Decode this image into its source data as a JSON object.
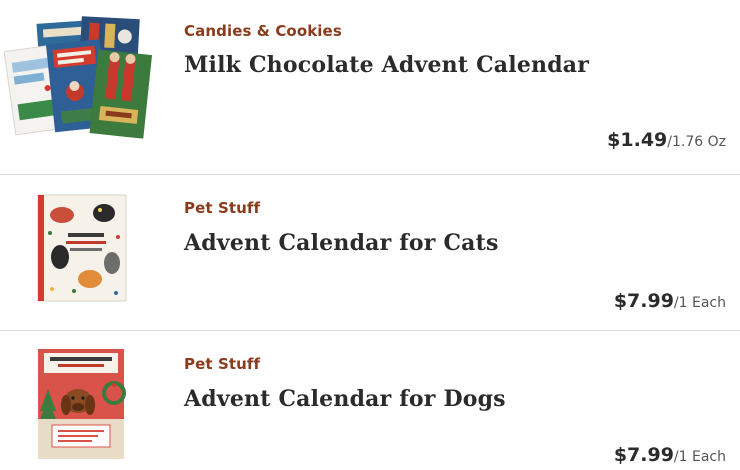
{
  "products": [
    {
      "category": "Candies & Cookies",
      "name": "Milk Chocolate Advent Calendar",
      "price": "$1.49",
      "unit": "/1.76 Oz",
      "image": "advent-calendars-assortment-image"
    },
    {
      "category": "Pet Stuff",
      "name": "Advent Calendar for Cats",
      "price": "$7.99",
      "unit": "/1 Each",
      "image": "cat-advent-calendar-image"
    },
    {
      "category": "Pet Stuff",
      "name": "Advent Calendar for Dogs",
      "price": "$7.99",
      "unit": "/1 Each",
      "image": "dog-advent-calendar-image"
    }
  ]
}
